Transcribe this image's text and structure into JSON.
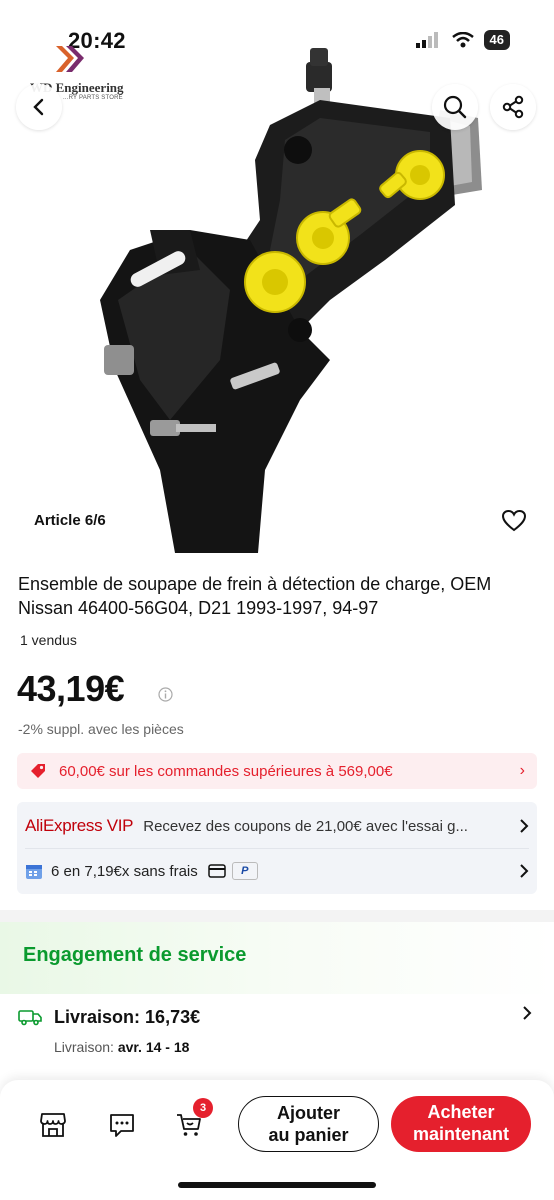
{
  "status_bar": {
    "time": "20:42",
    "battery": "46"
  },
  "brand_logo": {
    "name": "WD Engineering",
    "subtitle": "...RY PARTS STORE"
  },
  "gallery": {
    "article_counter": "Article 6/6"
  },
  "product": {
    "title": "Ensemble de soupape de frein à détection de charge, OEM Nissan 46400-56G04, D21 1993-1997, 94-97",
    "sold": "1 vendus",
    "price": "43,19€",
    "discount_note": "-2% suppl. avec les pièces"
  },
  "coupon": {
    "text": "60,00€ sur les commandes supérieures à 569,00€",
    "color": "#e5202d"
  },
  "vip": {
    "logo": "AliExpress VIP",
    "text": "Recevez des coupons de 21,00€ avec l'essai g..."
  },
  "installments": {
    "text": "6 en 7,19€x sans frais",
    "paypal_mark": "P"
  },
  "service": {
    "title": "Engagement de service",
    "delivery_label": "Livraison:",
    "delivery_price": "16,73€",
    "delivery_sub_label": "Livraison:",
    "delivery_dates": "avr. 14 - 18"
  },
  "bottom_bar": {
    "cart_count": "3",
    "add_to_cart_line1": "Ajouter",
    "add_to_cart_line2": "au panier",
    "buy_now_line1": "Acheter",
    "buy_now_line2": "maintenant"
  },
  "colors": {
    "accent_red": "#e5202d",
    "service_green": "#0a9a2e",
    "valve_yellow": "#f2e21a"
  },
  "icons": [
    "back-icon",
    "search-icon",
    "share-icon",
    "heart-icon",
    "info-icon",
    "coupon-tag-icon",
    "calendar-icon",
    "card-icon",
    "paypal-icon",
    "truck-icon",
    "store-icon",
    "chat-icon",
    "cart-icon",
    "chevron-right-icon"
  ]
}
